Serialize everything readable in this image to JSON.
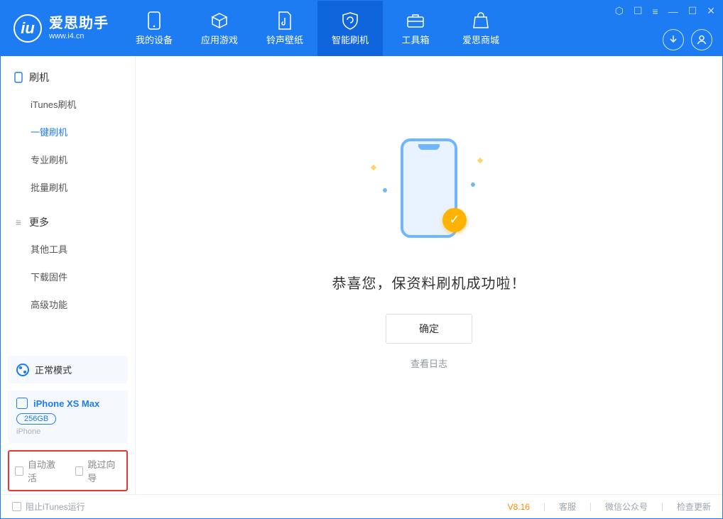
{
  "brand": {
    "name": "爱思助手",
    "url": "www.i4.cn"
  },
  "tabs": [
    {
      "id": "my-device",
      "label": "我的设备"
    },
    {
      "id": "apps-games",
      "label": "应用游戏"
    },
    {
      "id": "ring-wall",
      "label": "铃声壁纸"
    },
    {
      "id": "smart-flash",
      "label": "智能刷机",
      "active": true
    },
    {
      "id": "toolbox",
      "label": "工具箱"
    },
    {
      "id": "store",
      "label": "爱思商城"
    }
  ],
  "sidebar": {
    "flash_section": "刷机",
    "flash_items": [
      {
        "id": "itunes-flash",
        "label": "iTunes刷机"
      },
      {
        "id": "oneclick-flash",
        "label": "一键刷机",
        "active": true
      },
      {
        "id": "pro-flash",
        "label": "专业刷机"
      },
      {
        "id": "batch-flash",
        "label": "批量刷机"
      }
    ],
    "more_section": "更多",
    "more_items": [
      {
        "id": "other-tools",
        "label": "其他工具"
      },
      {
        "id": "download-fw",
        "label": "下载固件"
      },
      {
        "id": "advanced",
        "label": "高级功能"
      }
    ],
    "mode_label": "正常模式",
    "device": {
      "name": "iPhone XS Max",
      "storage": "256GB",
      "type": "iPhone"
    },
    "options": {
      "auto_activate": "自动激活",
      "skip_wizard": "跳过向导"
    }
  },
  "main": {
    "success_msg": "恭喜您，保资料刷机成功啦！",
    "ok_label": "确定",
    "view_log": "查看日志"
  },
  "footer": {
    "block_itunes": "阻止iTunes运行",
    "version": "V8.16",
    "support": "客服",
    "wechat": "微信公众号",
    "check_update": "检查更新"
  }
}
